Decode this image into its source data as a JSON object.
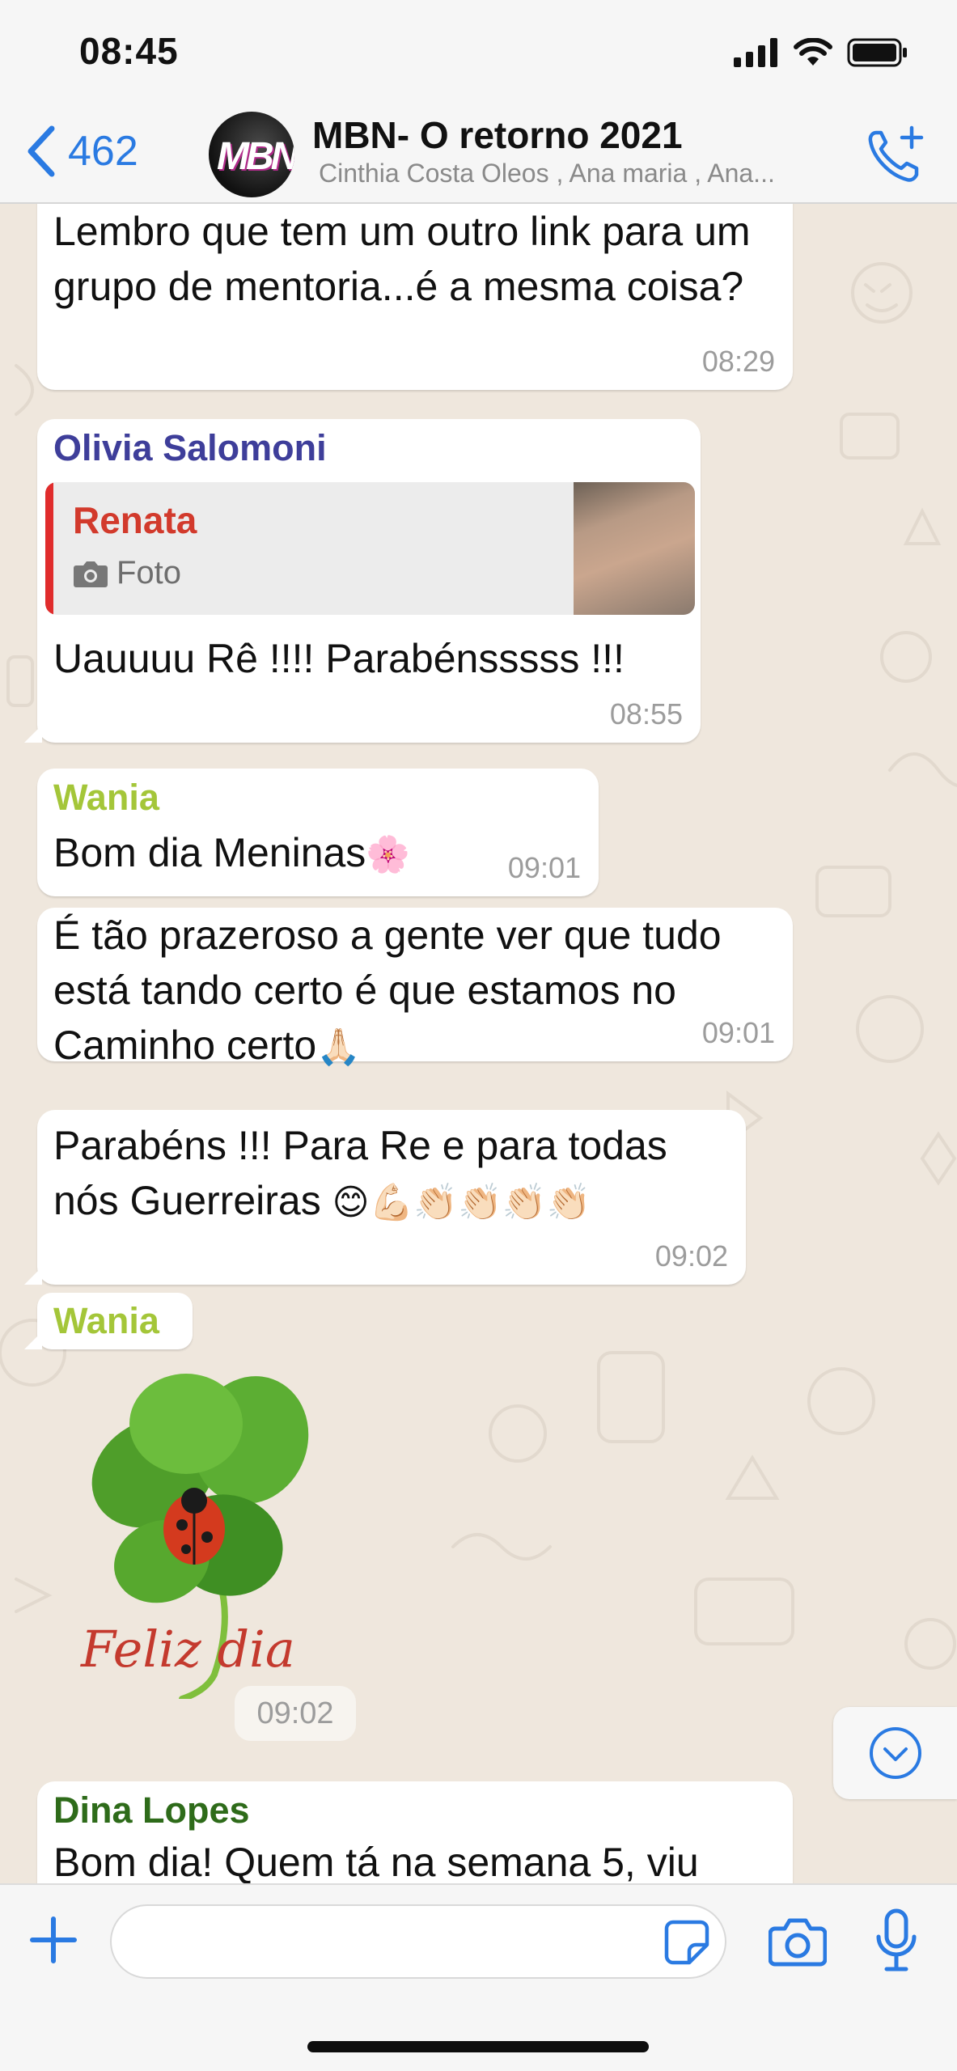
{
  "status_bar": {
    "time": "08:45"
  },
  "header": {
    "back_count": "462",
    "avatar_text": "MBN",
    "title": "MBN- O retorno 2021",
    "subtitle": "Cinthia Costa Oleos , Ana maria , Ana..."
  },
  "messages": [
    {
      "text": "Lembro que tem um outro link para um grupo de mentoria...é a mesma coisa?",
      "time": "08:29"
    },
    {
      "sender": "Olivia Salomoni",
      "quote": {
        "name": "Renata",
        "kind": "Foto"
      },
      "text": "Uauuuu Rê !!!! Parabénsssss !!!",
      "time": "08:55"
    },
    {
      "sender": "Wania",
      "text": "Bom dia Meninas",
      "emoji": "🌸",
      "time": "09:01"
    },
    {
      "line1": "É tão prazeroso a gente ver que tudo",
      "line2": "está tando certo é que estamos no",
      "line3": "Caminho certo",
      "emoji": "🙏🏻",
      "time": "09:01"
    },
    {
      "line1": "Parabéns !!! Para Re e para todas",
      "line2": "nós Guerreiras ",
      "emoji": "😊💪🏻👏🏻👏🏻👏🏻👏🏻",
      "time": "09:02"
    },
    {
      "sender": "Wania",
      "sticker_text": "Feliz dia",
      "time": "09:02"
    },
    {
      "sender": "Dina Lopes",
      "text": "Bom dia! Quem tá na semana 5, viu"
    }
  ],
  "colors": {
    "accent": "#2a7ae2",
    "sender_olivia": "#3e3e9a",
    "sender_wania": "#a4c639",
    "sender_dina": "#2e6b1a",
    "quote_name": "#d23a2c"
  },
  "input": {
    "placeholder": ""
  }
}
